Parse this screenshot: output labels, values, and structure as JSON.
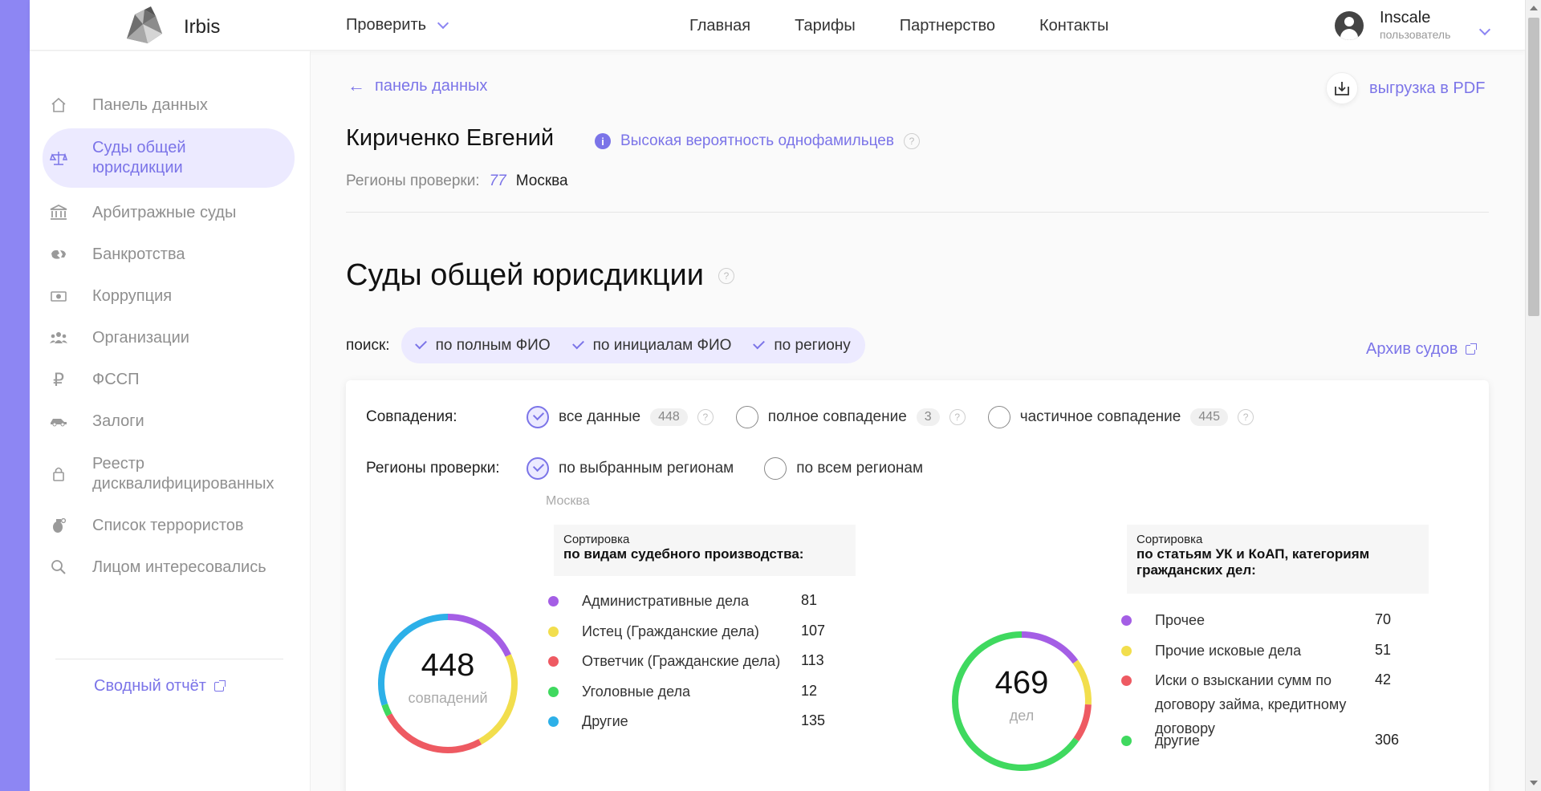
{
  "header": {
    "brand": "Irbis",
    "check_menu": "Проверить",
    "nav": [
      "Главная",
      "Тарифы",
      "Партнерство",
      "Контакты"
    ],
    "user_name": "Inscale",
    "user_role": "пользователь"
  },
  "sidebar": {
    "items": [
      {
        "label": "Панель данных",
        "icon": "home-icon"
      },
      {
        "label": "Суды общей юрисдикции",
        "icon": "scales-icon",
        "active": true
      },
      {
        "label": "Арбитражные суды",
        "icon": "bank-icon"
      },
      {
        "label": "Банкротства",
        "icon": "broken-piggy-icon"
      },
      {
        "label": "Коррупция",
        "icon": "money-icon"
      },
      {
        "label": "Организации",
        "icon": "people-icon"
      },
      {
        "label": "ФССП",
        "icon": "ruble-icon"
      },
      {
        "label": "Залоги",
        "icon": "car-icon"
      },
      {
        "label": "Реестр дисквалифицированных",
        "icon": "lock-icon"
      },
      {
        "label": "Список террористов",
        "icon": "grenade-icon"
      },
      {
        "label": "Лицом интересовались",
        "icon": "search-icon"
      }
    ],
    "summary_report": "Сводный отчёт"
  },
  "main": {
    "back_link": "панель данных",
    "pdf_button": "выгрузка в PDF",
    "person_name": "Кириченко Евгений",
    "homonym_warning": "Высокая вероятность однофамильцев",
    "regions_label": "Регионы проверки:",
    "region_code": "77",
    "region_city": "Москва",
    "section_title": "Суды общей юрисдикции",
    "search_label": "поиск:",
    "search_chips": [
      "по полным ФИО",
      "по инициалам ФИО",
      "по региону"
    ],
    "archive_link": "Архив судов",
    "matches": {
      "label": "Совпадения:",
      "options": [
        {
          "label": "все данные",
          "count": "448",
          "selected": true
        },
        {
          "label": "полное совпадение",
          "count": "3",
          "selected": false
        },
        {
          "label": "частичное совпадение",
          "count": "445",
          "selected": false
        }
      ]
    },
    "regions_filter": {
      "label": "Регионы проверки:",
      "options": [
        {
          "label": "по выбранным регионам",
          "selected": true
        },
        {
          "label": "по всем регионам",
          "selected": false
        }
      ],
      "selected_sub": "Москва"
    },
    "chart1": {
      "number": "448",
      "caption": "совпадений",
      "sort_title": "Сортировка",
      "sort_sub": "по видам судебного производства:",
      "legend": [
        {
          "label": "Административные дела",
          "value": "81",
          "color": "#a45ee5"
        },
        {
          "label": "Истец (Гражданские дела)",
          "value": "107",
          "color": "#f2de4d"
        },
        {
          "label": "Ответчик (Гражданские дела)",
          "value": "113",
          "color": "#ee5a62"
        },
        {
          "label": "Уголовные дела",
          "value": "12",
          "color": "#3fd95f"
        },
        {
          "label": "Другие",
          "value": "135",
          "color": "#2db0e8"
        }
      ]
    },
    "chart2": {
      "number": "469",
      "caption": "дел",
      "sort_title": "Сортировка",
      "sort_sub": "по статьям УК и КоАП, категориям гражданских дел:",
      "legend": [
        {
          "label": "Прочее",
          "value": "70",
          "color": "#a45ee5"
        },
        {
          "label": "Прочие исковые дела",
          "value": "51",
          "color": "#f2de4d"
        },
        {
          "label": "Иски о взыскании сумм по договору займа, кредитному договору",
          "value": "42",
          "color": "#ee5a62"
        },
        {
          "label": "другие",
          "value": "306",
          "color": "#3fd95f"
        }
      ]
    }
  }
}
